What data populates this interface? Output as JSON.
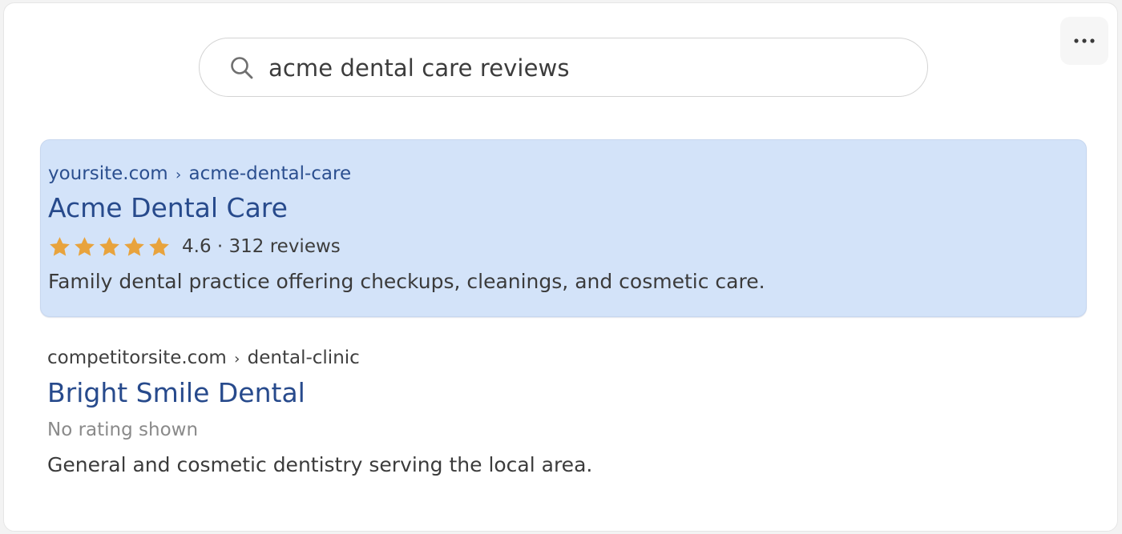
{
  "search": {
    "query": "acme dental care reviews",
    "icon": "search-icon"
  },
  "menu": {
    "icon": "more-horizontal-icon",
    "glyph": "•••"
  },
  "results": [
    {
      "domain": "yoursite.com",
      "separator": "›",
      "path": "acme-dental-care",
      "title": "Acme Dental Care",
      "rating": 4.6,
      "stars_filled": 5,
      "star_color": "#e8a33d",
      "rating_text": "4.6 · 312 reviews",
      "snippet": "Family dental practice offering checkups, cleanings, and cosmetic care.",
      "highlight_color": "#d3e3f9"
    },
    {
      "domain": "competitorsite.com",
      "separator": "›",
      "path": "dental-clinic",
      "title": "Bright Smile Dental",
      "rating_text": "No rating shown",
      "snippet": "General and cosmetic dentistry serving the local area."
    }
  ],
  "colors": {
    "link_title": "#274a8c",
    "breadcrumb_highlight": "#2b4f8f",
    "muted": "#8a8a8a"
  }
}
